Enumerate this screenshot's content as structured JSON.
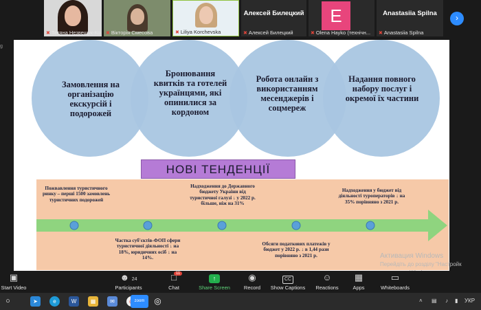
{
  "participants": [
    {
      "name": "Тетяна Незвещук-Ко...",
      "muted": true
    },
    {
      "name": "Вікторія Смесова",
      "muted": true
    },
    {
      "name": "Liliya Korchevska",
      "muted": true
    },
    {
      "display": "Алексей  Билецкий",
      "name": "Алексей Билецкий",
      "muted": true
    },
    {
      "initial": "E",
      "name": "Olena Hayko (технічн...",
      "muted": true
    },
    {
      "display": "Anastasiia Spilna",
      "name": "Anastasiia Spilna",
      "muted": true
    }
  ],
  "side_marker": "g",
  "slide": {
    "circles": [
      "Замовлення на організацію екскурсій і подорожей",
      "Бронювання квитків та готелей українцями, які опинилися за кордоном",
      "Робота онлайн з використанням месенджерів і соцмереж",
      "Надання повного набору послуг і окремої їх частини"
    ],
    "banner": "НОВІ ТЕНДЕНЦІЇ",
    "timeline_top": [
      "Пожвавлення туристичного ринку – перші 1500 замовлень туристичних подорожей",
      "Надходження до Державного бюджету України від туристичної галузі ↓ у 2022 р. більше, ніж на 31%",
      "Надходження у бюджет від діяльності туроператорів ↓ на 35% порівняно з 2021 р."
    ],
    "timeline_bottom": [
      "Частка суб'єктів-ФОП сфери туристичної діяльності ↓ на 18%, юридичних осіб ↓ на 14%.",
      "Обсяги податкових платежів у бюджет у 2022 р. ↓ в 1,44 рази порівняно з 2021 р."
    ]
  },
  "watermark": {
    "title": "Активация Windows",
    "line1": "Перейдіть до розділу \"Настройк",
    "line2": "активувати Windows."
  },
  "toolbar": {
    "start_video": "Start Video",
    "participants": "Participants",
    "participants_count": "24",
    "chat": "Chat",
    "chat_badge": "11",
    "share_screen": "Share Screen",
    "record": "Record",
    "show_captions": "Show Captions",
    "cc": "CC",
    "reactions": "Reactions",
    "apps": "Apps",
    "whiteboards": "Whiteboards"
  },
  "taskbar": {
    "zoom_label": "zoom",
    "language": "УКР"
  },
  "colors": {
    "circle": "#a9c6e2",
    "banner": "#b57bd6",
    "timeline_bg": "#f6c9a8",
    "arrow": "#8fd47f",
    "node": "#5aa0d9"
  }
}
